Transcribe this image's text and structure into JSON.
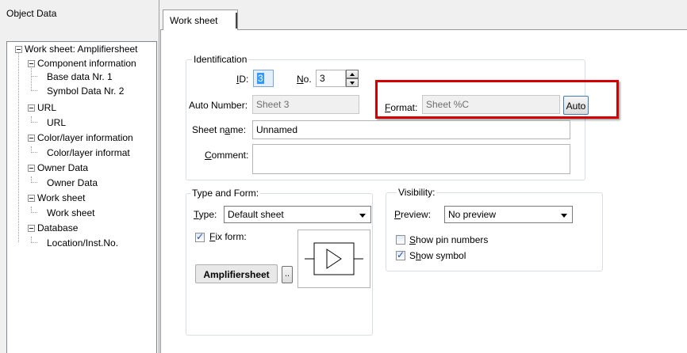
{
  "left_panel": {
    "title": "Object Data",
    "tree": [
      {
        "label": "Work sheet: Amplifiersheet",
        "level": 0
      },
      {
        "label": "Component information",
        "level": 1
      },
      {
        "label": "Base data Nr. 1",
        "level": 2
      },
      {
        "label": "Symbol Data Nr. 2",
        "level": 2
      },
      {
        "label": "URL",
        "level": 1
      },
      {
        "label": "URL",
        "level": 2
      },
      {
        "label": "Color/layer information",
        "level": 1
      },
      {
        "label": "Color/layer informat",
        "level": 2
      },
      {
        "label": "Owner Data",
        "level": 1
      },
      {
        "label": "Owner Data",
        "level": 2
      },
      {
        "label": "Work sheet",
        "level": 1
      },
      {
        "label": "Work sheet",
        "level": 2
      },
      {
        "label": "Database",
        "level": 1
      },
      {
        "label": "Location/Inst.No.",
        "level": 2
      }
    ]
  },
  "tab": {
    "label": "Work sheet"
  },
  "identification": {
    "title": "Identification",
    "id_label": "ID:",
    "id_value": "3",
    "no_label": "No.",
    "no_value": "3",
    "auto_number_label": "Auto Number:",
    "auto_number_value": "Sheet 3",
    "format_label": "Format:",
    "format_value": "Sheet %C",
    "auto_button": "Auto",
    "sheet_name_label": "Sheet name:",
    "sheet_name_value": "Unnamed",
    "comment_label": "Comment:",
    "comment_value": "",
    "highlight_color": "#d40000"
  },
  "type_form": {
    "title": "Type and Form:",
    "type_label": "Type:",
    "type_value": "Default sheet",
    "fix_form_label": "Fix form:",
    "fix_form_checked": true,
    "form_name": "Amplifiersheet",
    "browse_button": ".."
  },
  "visibility": {
    "title": "Visibility:",
    "preview_label": "Preview:",
    "preview_value": "No preview",
    "show_pin_numbers_label": "Show pin numbers",
    "show_pin_numbers_checked": false,
    "show_symbol_label": "Show symbol",
    "show_symbol_checked": true
  }
}
